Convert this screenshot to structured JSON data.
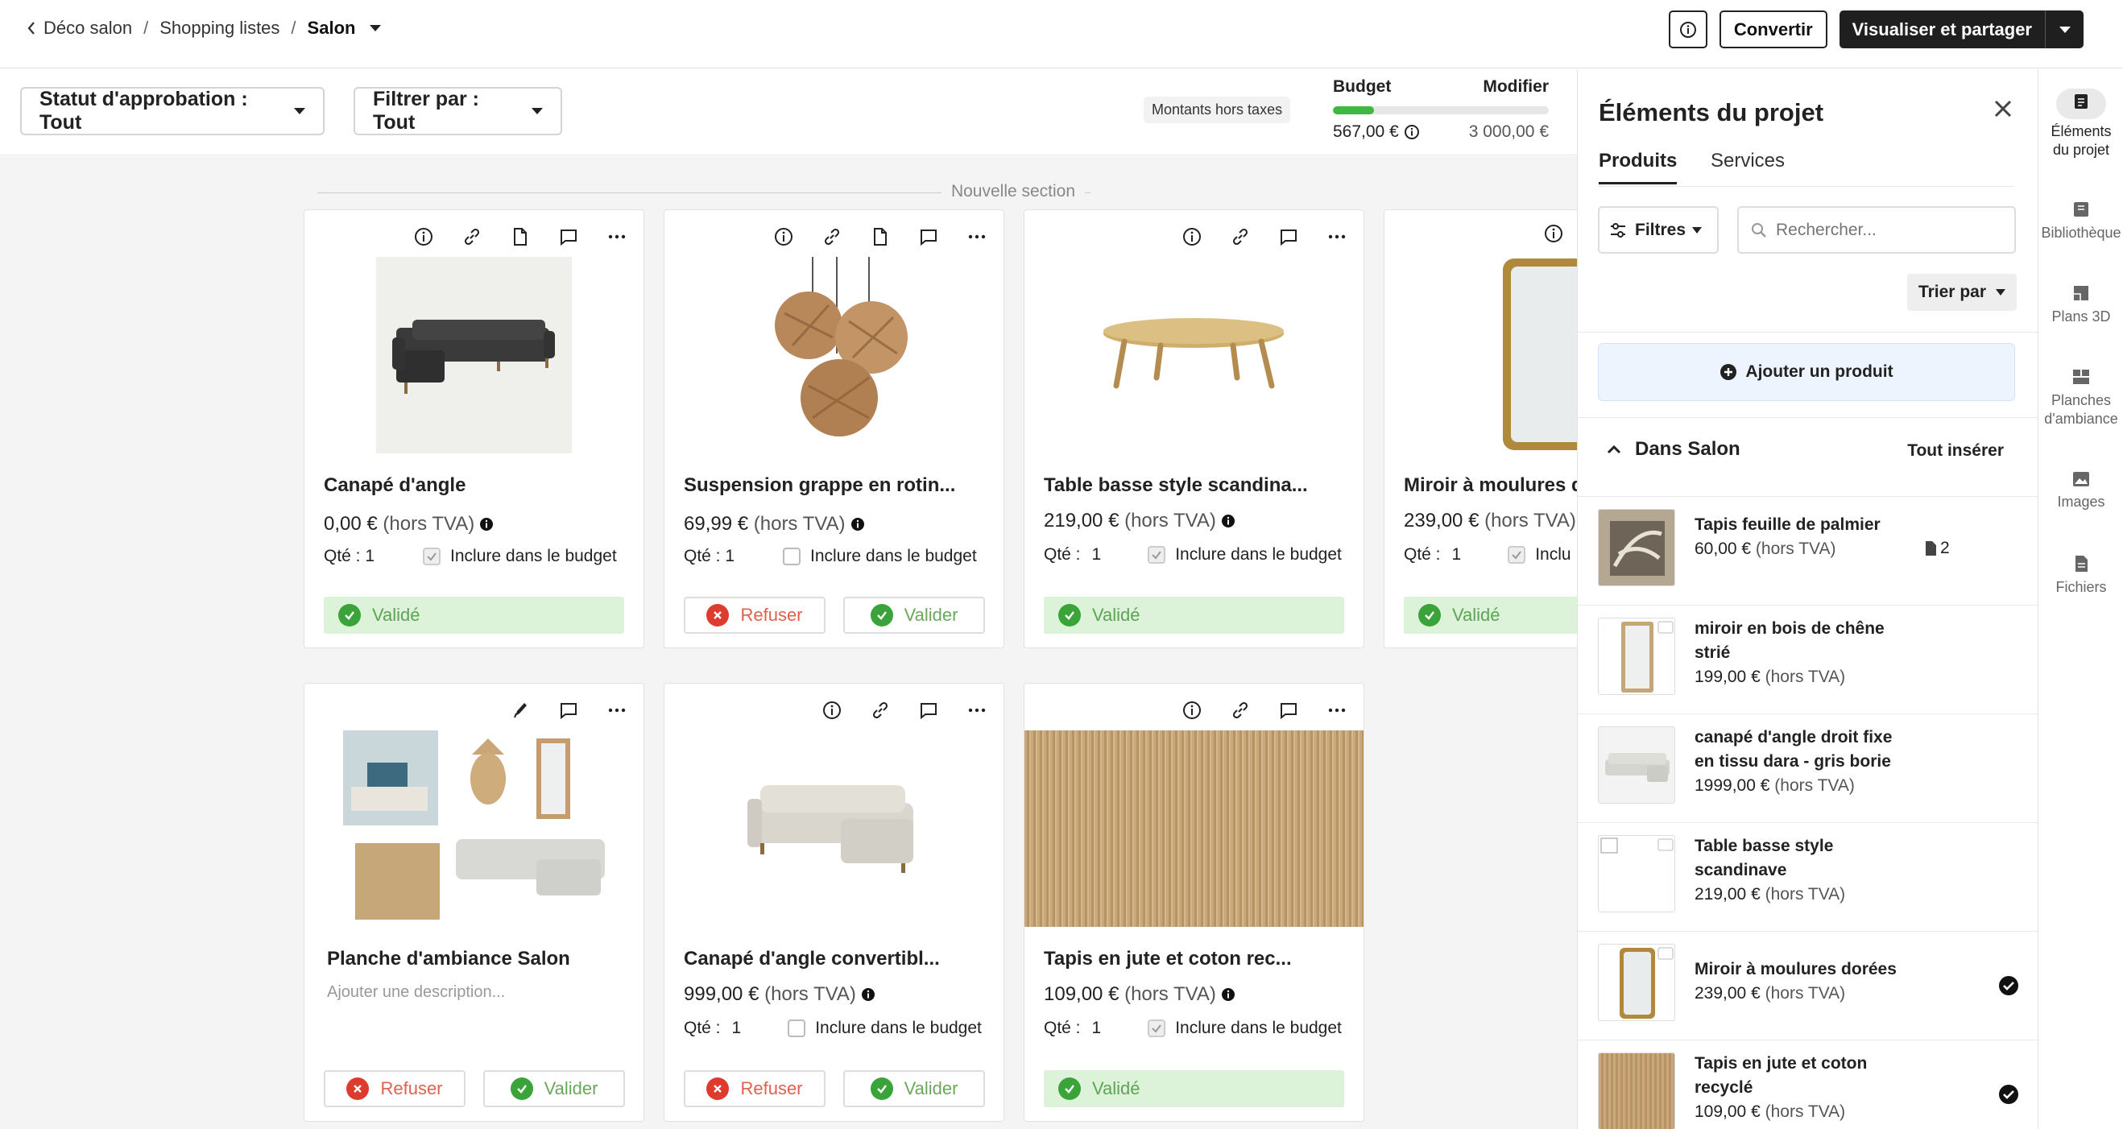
{
  "breadcrumb": {
    "items": [
      "Déco salon",
      "Shopping listes",
      "Salon"
    ]
  },
  "topbar": {
    "convert_label": "Convertir",
    "share_label": "Visualiser et partager"
  },
  "filters": {
    "approval_label": "Statut d'approbation : Tout",
    "filter_label": "Filtrer par : Tout",
    "tax_tag": "Montants hors taxes"
  },
  "budget": {
    "label": "Budget",
    "edit_label": "Modifier",
    "spent": "567,00 €",
    "total": "3 000,00 €",
    "progress": 0.19
  },
  "section": {
    "title": "Nouvelle section"
  },
  "cards": [
    {
      "title": "Canapé d'angle",
      "price": "0,00 €",
      "tax": "(hors TVA)",
      "qty": "Qté : 1",
      "budget_label": "Inclure dans le budget",
      "status": "Validé"
    },
    {
      "title": "Suspension grappe en rotin...",
      "price": "69,99 €",
      "tax": "(hors TVA)",
      "qty": "Qté : 1",
      "budget_label": "Inclure dans le budget",
      "refuse": "Refuser",
      "validate": "Valider"
    },
    {
      "title": "Table basse style scandina...",
      "price": "219,00 €",
      "tax": "(hors TVA)",
      "qty": "Qté :",
      "qty_val": "1",
      "budget_label": "Inclure dans le budget",
      "status": "Validé"
    },
    {
      "title": "Miroir à moulures do",
      "price": "239,00 €",
      "tax": "(hors TVA)",
      "qty": "Qté :",
      "qty_val": "1",
      "budget_label": "Inclu",
      "status": "Validé"
    },
    {
      "title": "Planche d'ambiance Salon",
      "description_placeholder": "Ajouter une description...",
      "refuse": "Refuser",
      "validate": "Valider"
    },
    {
      "title": "Canapé d'angle convertibl...",
      "price": "999,00 €",
      "tax": "(hors TVA)",
      "qty": "Qté :",
      "qty_val": "1",
      "budget_label": "Inclure dans le budget",
      "refuse": "Refuser",
      "validate": "Valider"
    },
    {
      "title": "Tapis en jute et coton rec...",
      "price": "109,00 €",
      "tax": "(hors TVA)",
      "qty": "Qté :",
      "qty_val": "1",
      "budget_label": "Inclure dans le budget",
      "status": "Validé"
    }
  ],
  "panel": {
    "title": "Éléments du projet",
    "tabs": [
      "Produits",
      "Services"
    ],
    "filters_label": "Filtres",
    "search_placeholder": "Rechercher...",
    "sort_label": "Trier par",
    "add_label": "Ajouter un produit",
    "group_title": "Dans Salon",
    "insert_all": "Tout insérer",
    "items": [
      {
        "name": "Tapis feuille de palmier",
        "price": "60,00 €",
        "tax": "(hors TVA)",
        "count": "2"
      },
      {
        "name": "miroir en bois de chêne",
        "name2": "strié",
        "price": "199,00 €",
        "tax": "(hors TVA)"
      },
      {
        "name": "canapé d'angle droit fixe",
        "name2": "en tissu dara - gris borie",
        "price": "1999,00 €",
        "tax": "(hors TVA)"
      },
      {
        "name": "Table basse style",
        "name2": "scandinave",
        "price": "219,00 €",
        "tax": "(hors TVA)"
      },
      {
        "name": "Miroir à moulures dorées",
        "price": "239,00 €",
        "tax": "(hors TVA)"
      },
      {
        "name": "Tapis en jute et coton",
        "name2": "recyclé",
        "price": "109,00 €",
        "tax": "(hors TVA)"
      }
    ]
  },
  "rail": [
    {
      "l1": "Éléments",
      "l2": "du projet"
    },
    {
      "l1": "Bibliothèque",
      "l2": ""
    },
    {
      "l1": "Plans 3D",
      "l2": ""
    },
    {
      "l1": "Planches",
      "l2": "d'ambiance"
    },
    {
      "l1": "Images",
      "l2": ""
    },
    {
      "l1": "Fichiers",
      "l2": ""
    }
  ]
}
